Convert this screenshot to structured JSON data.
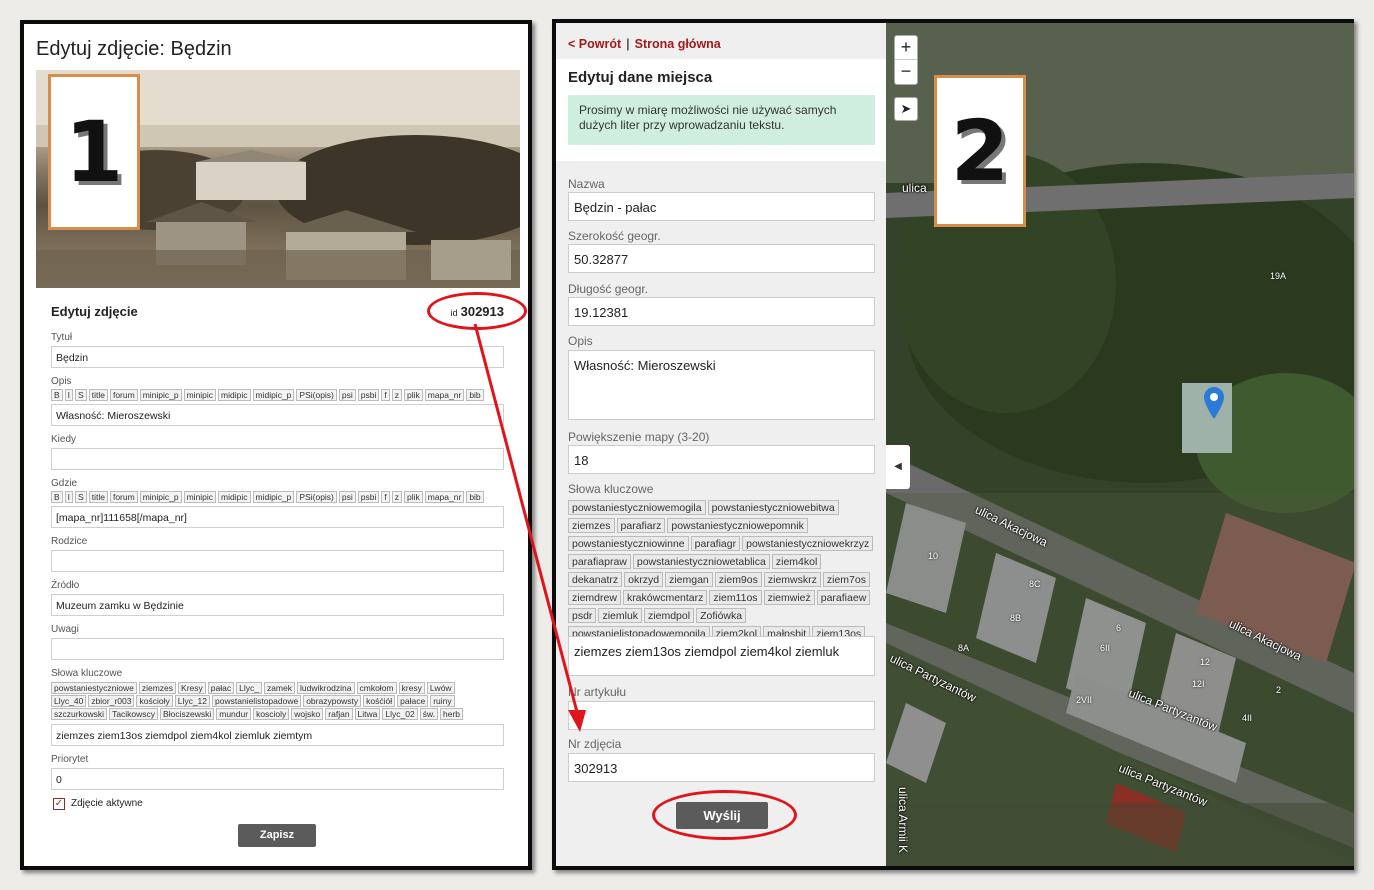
{
  "panel1": {
    "title": "Edytuj zdjęcie: Będzin",
    "badge": "1",
    "section_title": "Edytuj zdjęcie",
    "id_prefix": "id",
    "id_value": "302913",
    "fields": {
      "tytul_label": "Tytuł",
      "tytul_value": "Będzin",
      "opis_label": "Opis",
      "opis_value": "Własność: Mieroszewski",
      "kiedy_label": "Kiedy",
      "kiedy_value": "",
      "gdzie_label": "Gdzie",
      "gdzie_value": "[mapa_nr]111658[/mapa_nr]",
      "rodzice_label": "Rodzice",
      "rodzice_value": "",
      "zrodlo_label": "Źródło",
      "zrodlo_value": "Muzeum zamku w Będzinie",
      "uwagi_label": "Uwagi",
      "uwagi_value": "",
      "slowa_label": "Słowa kluczowe",
      "slowa_value": "ziemzes ziem13os ziemdpol ziem4kol ziemluk ziemtym",
      "priorytet_label": "Priorytet",
      "priorytet_value": "0"
    },
    "toolbar": [
      "B",
      "I",
      "S",
      "title",
      "forum",
      "minipic_p",
      "minipic",
      "midipic",
      "midipic_p",
      "PSi(opis)",
      "psi",
      "psbi",
      "f",
      "z",
      "plik",
      "mapa_nr",
      "bib"
    ],
    "tags": [
      "powstaniestyczniowe",
      "ziemzes",
      "Kresy",
      "pałac",
      "Llyc_",
      "zamek",
      "ludwikrodzina",
      "cmkołom",
      "kresy",
      "Lwów",
      "Llyc_40",
      "zbior_r003",
      "kościoły",
      "Llyc_12",
      "powstanielistopadowe",
      "obrazypowsty",
      "kośćiół",
      "pałace",
      "ruiny",
      "szczurkowski",
      "Tacikowscy",
      "Błociszewski",
      "mundur",
      "koscioly",
      "wojsko",
      "rafjan",
      "Litwa",
      "Llyc_02",
      "św.",
      "herb"
    ],
    "active_label": "Zdjęcie aktywne",
    "save_label": "Zapisz"
  },
  "panel2": {
    "badge": "2",
    "nav_back": "< Powrót",
    "nav_sep": "|",
    "nav_home": "Strona główna",
    "heading": "Edytuj dane miejsca",
    "note": "Prosimy w miarę możliwości nie używać samych dużych liter przy wprowadzaniu tekstu.",
    "nazwa_label": "Nazwa",
    "nazwa_value": "Będzin - pałac",
    "lat_label": "Szerokość geogr.",
    "lat_value": "50.32877",
    "lon_label": "Długość geogr.",
    "lon_value": "19.12381",
    "opis_label": "Opis",
    "opis_value": "Własność: Mieroszewski",
    "zoom_label": "Powiększenie mapy (3-20)",
    "zoom_value": "18",
    "slowa_label": "Słowa kluczowe",
    "tags": [
      "powstaniestyczniowemogila",
      "powstaniestyczniowebitwa",
      "ziemzes",
      "parafiarz",
      "powstaniestyczniowepomnik",
      "powstaniestyczniowinne",
      "parafiagr",
      "powstaniestyczniowekrzyz",
      "parafiapraw",
      "powstaniestyczniowetablica",
      "ziem4kol",
      "dekanatrz",
      "okrzyd",
      "ziemgan",
      "ziem9os",
      "ziemwskrz",
      "ziem7os",
      "ziemdrew",
      "krakówcmentarz",
      "ziem11os",
      "ziemwież",
      "parafiaew",
      "psdr",
      "ziemluk",
      "ziemdpol",
      "Zofiówka",
      "powstanielistopadowemogila",
      "ziem2kol",
      "małpsbit",
      "ziem13os"
    ],
    "slowa_value": "ziemzes ziem13os ziemdpol ziem4kol ziemluk",
    "artykul_label": "Nr artykułu",
    "artykul_value": "",
    "zdjecie_label": "Nr zdjęcia",
    "zdjecie_value": "302913",
    "submit_label": "Wyślij"
  },
  "map": {
    "zoom_in": "+",
    "zoom_out": "−",
    "streets": [
      "ulica",
      "ulica Akacjowa",
      "ulica Akacjowa",
      "ulica Partyzantów",
      "ulica Partyzantów",
      "ulica Partyzantów",
      "ulica Armii K"
    ],
    "numbers": [
      "19A",
      "10",
      "8C",
      "8B",
      "6",
      "6II",
      "8A",
      "12",
      "12I",
      "2",
      "2VII",
      "4II"
    ]
  },
  "colors": {
    "accent": "#a01c1c",
    "annotation": "#e0141b",
    "badge_border": "#d98d4a",
    "note_bg": "#cfeee0",
    "button": "#5b5b5b"
  }
}
